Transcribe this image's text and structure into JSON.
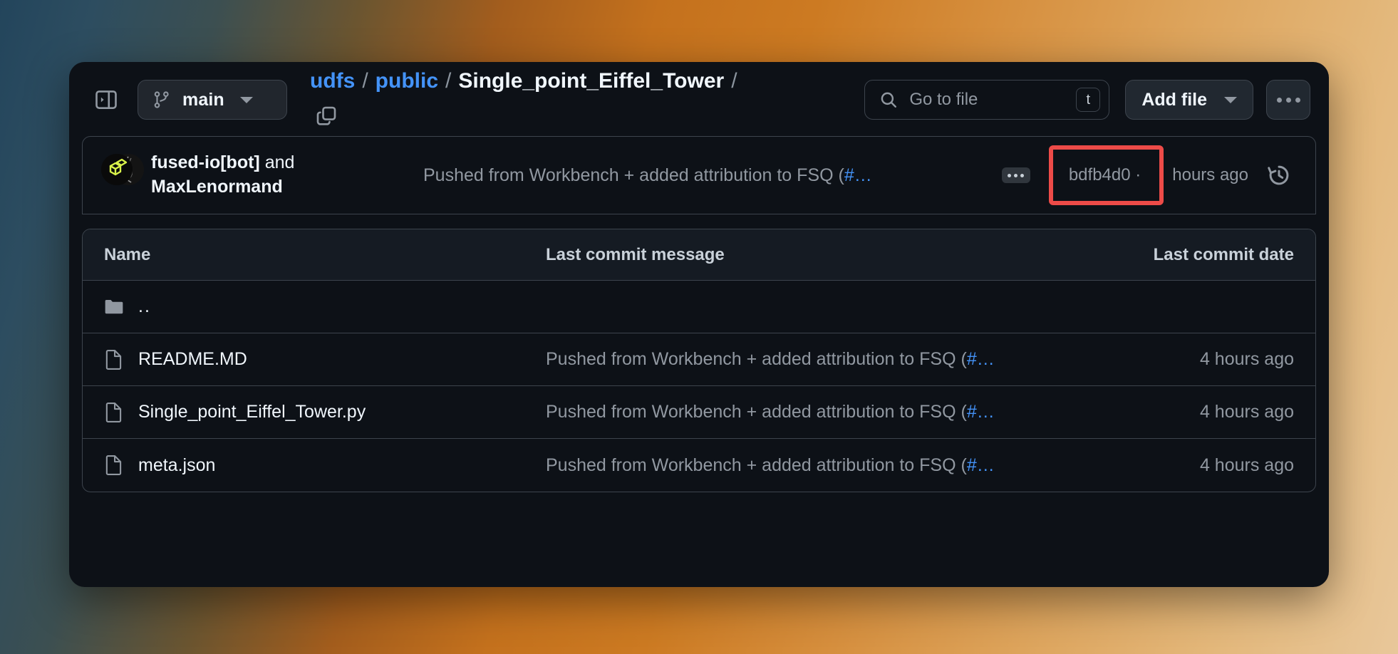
{
  "header": {
    "sidebar_toggle_icon": "sidebar-expand-icon",
    "branch": {
      "icon": "git-branch-icon",
      "name": "main",
      "caret_icon": "chevron-down-icon"
    },
    "breadcrumb": {
      "segments": [
        {
          "label": "udfs",
          "type": "link"
        },
        {
          "label": "public",
          "type": "link"
        },
        {
          "label": "Single_point_Eiffel_Tower",
          "type": "current"
        }
      ],
      "separator": "/",
      "trailing_separator": "/",
      "copy_icon": "copy-path-icon"
    },
    "search": {
      "icon": "search-icon",
      "placeholder": "Go to file",
      "value": "",
      "shortcut_key": "t"
    },
    "add_file": {
      "label": "Add file",
      "caret_icon": "chevron-down-icon"
    },
    "more_menu": {
      "icon": "kebab-horizontal-icon"
    }
  },
  "commit_banner": {
    "authors": {
      "avatar_primary": "fused-io-bot-avatar",
      "avatar_secondary": "maxlenormand-avatar",
      "primary_name": "fused-io[bot]",
      "conjunction": "and",
      "secondary_name": "MaxLenormand"
    },
    "message": "Pushed from Workbench + added attribution to FSQ (",
    "issue_ref": "#…",
    "expand_icon": "ellipsis-expand-icon",
    "commit_hash": "bdfb4d0 ·",
    "relative_time": "hours ago",
    "history_icon": "history-icon",
    "highlight_color": "#ed4b48"
  },
  "file_table": {
    "columns": {
      "name": "Name",
      "message": "Last commit message",
      "date": "Last commit date"
    },
    "rows": [
      {
        "icon": "folder-icon",
        "name": "..",
        "message": "",
        "date": ""
      },
      {
        "icon": "file-icon",
        "name": "README.MD",
        "message": "Pushed from Workbench + added attribution to FSQ (",
        "issue_ref": "#…",
        "date": "4 hours ago"
      },
      {
        "icon": "file-icon",
        "name": "Single_point_Eiffel_Tower.py",
        "message": "Pushed from Workbench + added attribution to FSQ (",
        "issue_ref": "#…",
        "date": "4 hours ago"
      },
      {
        "icon": "file-icon",
        "name": "meta.json",
        "message": "Pushed from Workbench + added attribution to FSQ (",
        "issue_ref": "#…",
        "date": "4 hours ago"
      }
    ]
  }
}
